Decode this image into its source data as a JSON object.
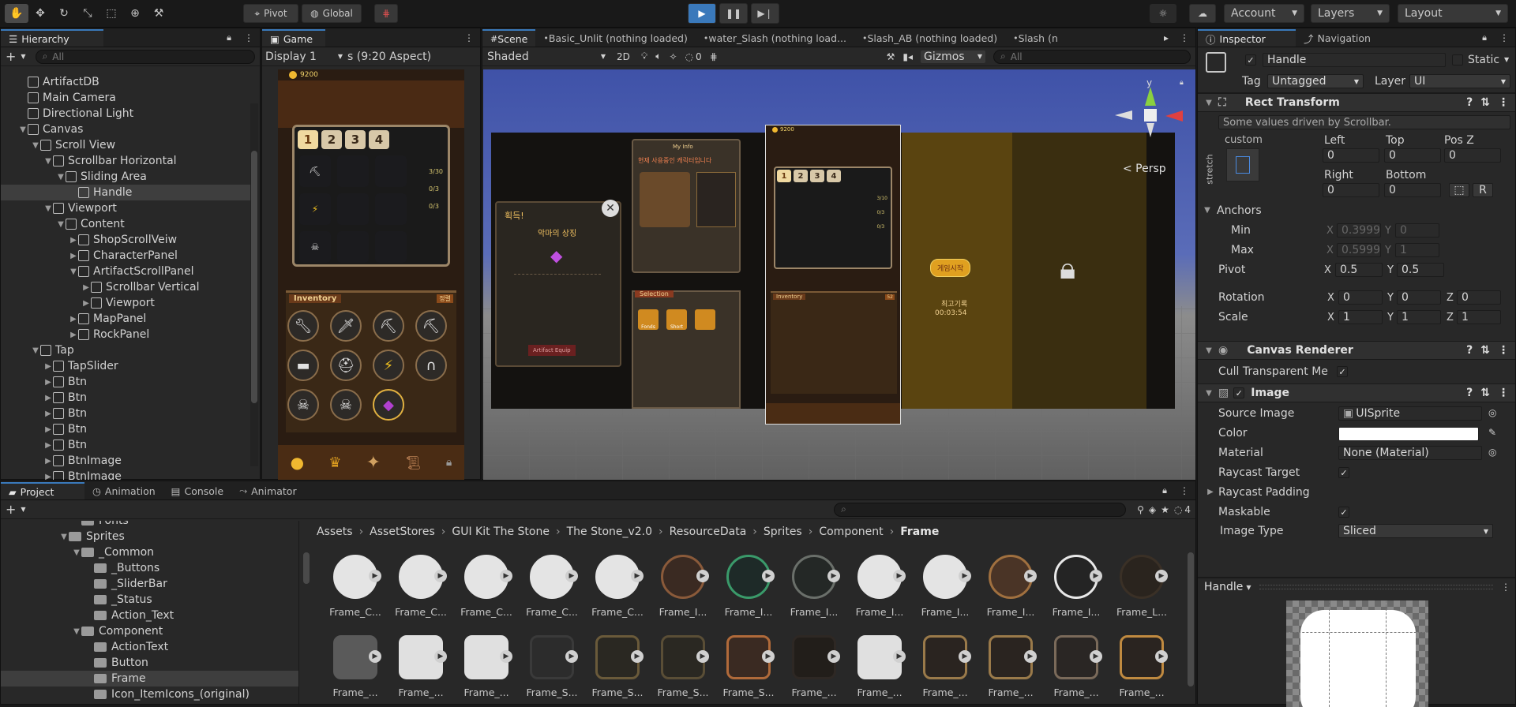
{
  "toolbar": {
    "pivot_label": "Pivot",
    "global_label": "Global",
    "account_label": "Account",
    "layers_label": "Layers",
    "layout_label": "Layout",
    "tool_icons": [
      "hand-icon",
      "move-icon",
      "rotate-icon",
      "scale-icon",
      "rect-icon",
      "transform-icon",
      "custom-tool-icon"
    ]
  },
  "hierarchy": {
    "tab_label": "Hierarchy",
    "search_placeholder": "All",
    "items": [
      {
        "label": "ArtifactDB",
        "indent": 3,
        "arrow": ""
      },
      {
        "label": "Main Camera",
        "indent": 3,
        "arrow": ""
      },
      {
        "label": "Directional Light",
        "indent": 3,
        "arrow": ""
      },
      {
        "label": "Canvas",
        "indent": 3,
        "arrow": "▼"
      },
      {
        "label": "Scroll View",
        "indent": 4,
        "arrow": "▼"
      },
      {
        "label": "Scrollbar Horizontal",
        "indent": 5,
        "arrow": "▼"
      },
      {
        "label": "Sliding Area",
        "indent": 6,
        "arrow": "▼"
      },
      {
        "label": "Handle",
        "indent": 7,
        "arrow": "",
        "selected": true
      },
      {
        "label": "Viewport",
        "indent": 5,
        "arrow": "▼"
      },
      {
        "label": "Content",
        "indent": 6,
        "arrow": "▼"
      },
      {
        "label": "ShopScrollVeiw",
        "indent": 7,
        "arrow": "▶"
      },
      {
        "label": "CharacterPanel",
        "indent": 7,
        "arrow": "▶"
      },
      {
        "label": "ArtifactScrollPanel",
        "indent": 7,
        "arrow": "▼"
      },
      {
        "label": "Scrollbar Vertical",
        "indent": 8,
        "arrow": "▶"
      },
      {
        "label": "Viewport",
        "indent": 8,
        "arrow": "▶"
      },
      {
        "label": "MapPanel",
        "indent": 7,
        "arrow": "▶"
      },
      {
        "label": "RockPanel",
        "indent": 7,
        "arrow": "▶"
      },
      {
        "label": "Tap",
        "indent": 4,
        "arrow": "▼"
      },
      {
        "label": "TapSlider",
        "indent": 5,
        "arrow": "▶"
      },
      {
        "label": "Btn",
        "indent": 5,
        "arrow": "▶"
      },
      {
        "label": "Btn",
        "indent": 5,
        "arrow": "▶"
      },
      {
        "label": "Btn",
        "indent": 5,
        "arrow": "▶"
      },
      {
        "label": "Btn",
        "indent": 5,
        "arrow": "▶"
      },
      {
        "label": "Btn",
        "indent": 5,
        "arrow": "▶"
      },
      {
        "label": "BtnImage",
        "indent": 5,
        "arrow": "▶"
      },
      {
        "label": "BtnImage",
        "indent": 5,
        "arrow": "▶"
      }
    ]
  },
  "game": {
    "tab_label": "Game",
    "display_label": "Display 1",
    "aspect_label": "s (9:20 Aspect)",
    "coin_value": "9200",
    "tabs": [
      "1",
      "2",
      "3",
      "4"
    ],
    "counters": [
      "3/30",
      "0/3",
      "0/3"
    ],
    "inventory_label": "Inventory",
    "inventory_badge": "정렬"
  },
  "scene": {
    "tabs": [
      {
        "label": "Scene",
        "active": true
      },
      {
        "label": "Basic_Unlit (nothing loaded)"
      },
      {
        "label": "water_Slash (nothing load..."
      },
      {
        "label": "Slash_AB (nothing loaded)"
      },
      {
        "label": "Slash (n"
      }
    ],
    "shading_label": "Shaded",
    "mode_2d": "2D",
    "hidden_count": "0",
    "gizmos_label": "Gizmos",
    "search_placeholder": "All",
    "persp_label": "< Persp",
    "gizmo_axis_y": "y",
    "card_popup_title": "획득!",
    "card_popup_item": "악마의 상징",
    "card_popup_btn": "Artifact Equip",
    "my_info_title": "My Info",
    "my_info_subtitle": "현재 사용중인 캐릭터입니다",
    "selection_label": "Selection",
    "selection_items": [
      "Fonds",
      "Short",
      ""
    ],
    "mid_coin": "9200",
    "mid_tabs": [
      "1",
      "2",
      "3",
      "4"
    ],
    "mid_counters": [
      "3/10",
      "0/3",
      "0/3"
    ],
    "mid_inventory_label": "Inventory",
    "mid_inventory_badge": "52",
    "start_btn": "게임시작",
    "best_record_label": "최고기록",
    "best_record_time": "00:03:54"
  },
  "inspector": {
    "tab_label": "Inspector",
    "nav_tab_label": "Navigation",
    "object_name": "Handle",
    "static_label": "Static",
    "tag_label": "Tag",
    "tag_value": "Untagged",
    "layer_label": "Layer",
    "layer_value": "UI",
    "rect_transform": {
      "title": "Rect Transform",
      "note": "Some values driven by Scrollbar.",
      "preset_label": "custom",
      "stretch_label": "stretch",
      "left_label": "Left",
      "left_value": "0",
      "top_label": "Top",
      "top_value": "0",
      "posz_label": "Pos Z",
      "posz_value": "0",
      "right_label": "Right",
      "right_value": "0",
      "bottom_label": "Bottom",
      "bottom_value": "0",
      "anchors_label": "Anchors",
      "min_label": "Min",
      "min_x": "0.3999",
      "min_y": "0",
      "max_label": "Max",
      "max_x": "0.5999",
      "max_y": "1",
      "pivot_label": "Pivot",
      "pivot_x": "0.5",
      "pivot_y": "0.5",
      "rotation_label": "Rotation",
      "rot_x": "0",
      "rot_y": "0",
      "rot_z": "0",
      "scale_label": "Scale",
      "scale_x": "1",
      "scale_y": "1",
      "scale_z": "1",
      "r_button": "R"
    },
    "canvas_renderer": {
      "title": "Canvas Renderer",
      "cull_label": "Cull Transparent Me"
    },
    "image": {
      "title": "Image",
      "source_label": "Source Image",
      "source_value": "UISprite",
      "color_label": "Color",
      "color_value": "#ffffff",
      "material_label": "Material",
      "material_value": "None (Material)",
      "raycast_target_label": "Raycast Target",
      "raycast_padding_label": "Raycast Padding",
      "maskable_label": "Maskable",
      "image_type_label": "Image Type",
      "image_type_value": "Sliced"
    },
    "preview_label": "Handle"
  },
  "project": {
    "tabs": [
      {
        "label": "Project",
        "active": true
      },
      {
        "label": "Animation"
      },
      {
        "label": "Console"
      },
      {
        "label": "Animator"
      }
    ],
    "hidden_count": "4",
    "folders": [
      {
        "label": "Fonts",
        "indent": 6,
        "arrow": ""
      },
      {
        "label": "Sprites",
        "indent": 5,
        "arrow": "▼"
      },
      {
        "label": "_Common",
        "indent": 6,
        "arrow": "▼"
      },
      {
        "label": "_Buttons",
        "indent": 7,
        "arrow": ""
      },
      {
        "label": "_SliderBar",
        "indent": 7,
        "arrow": ""
      },
      {
        "label": "_Status",
        "indent": 7,
        "arrow": ""
      },
      {
        "label": "Action_Text",
        "indent": 7,
        "arrow": ""
      },
      {
        "label": "Component",
        "indent": 6,
        "arrow": "▼"
      },
      {
        "label": "ActionText",
        "indent": 7,
        "arrow": ""
      },
      {
        "label": "Button",
        "indent": 7,
        "arrow": ""
      },
      {
        "label": "Frame",
        "indent": 7,
        "arrow": "",
        "selected": true
      },
      {
        "label": "Icon_ItemIcons_(original)",
        "indent": 7,
        "arrow": ""
      }
    ],
    "breadcrumb": [
      "Assets",
      "AssetStores",
      "GUI Kit The Stone",
      "The Stone_v2.0",
      "ResourceData",
      "Sprites",
      "Component",
      "Frame"
    ],
    "assets_row1": [
      {
        "label": "Frame_C...",
        "color": "#e4e4e4",
        "ring": "#e4e4e4"
      },
      {
        "label": "Frame_C...",
        "color": "#e4e4e4",
        "ring": "#e4e4e4"
      },
      {
        "label": "Frame_C...",
        "color": "#e4e4e4",
        "ring": "#e4e4e4"
      },
      {
        "label": "Frame_C...",
        "color": "#e4e4e4",
        "ring": "#e4e4e4"
      },
      {
        "label": "Frame_C...",
        "color": "#e4e4e4",
        "ring": "#e4e4e4"
      },
      {
        "label": "Frame_I...",
        "color": "#3a2a22",
        "ring": "#8a5a3a"
      },
      {
        "label": "Frame_I...",
        "color": "#1e2a28",
        "ring": "#3a9a6a"
      },
      {
        "label": "Frame_I...",
        "color": "#242826",
        "ring": "#6a6f6a"
      },
      {
        "label": "Frame_I...",
        "color": "#e4e4e4",
        "ring": "#e4e4e4"
      },
      {
        "label": "Frame_I...",
        "color": "#e4e4e4",
        "ring": "#e4e4e4"
      },
      {
        "label": "Frame_I...",
        "color": "#4a3426",
        "ring": "#a0703f"
      },
      {
        "label": "Frame_I...",
        "color": "#242424",
        "ring": "#e8e8e8"
      },
      {
        "label": "Frame_L...",
        "color": "#2a241e",
        "ring": "#3a3026"
      }
    ],
    "assets_row2": [
      {
        "label": "Frame_...",
        "color": "#5a5a5a",
        "ring": "#5a5a5a"
      },
      {
        "label": "Frame_...",
        "color": "#e0e0e0",
        "ring": "#e0e0e0"
      },
      {
        "label": "Frame_...",
        "color": "#e0e0e0",
        "ring": "#e0e0e0"
      },
      {
        "label": "Frame_S...",
        "color": "#2c2c2c",
        "ring": "#3a3a3a"
      },
      {
        "label": "Frame_S...",
        "color": "#2a2822",
        "ring": "#6a5a3a"
      },
      {
        "label": "Frame_S...",
        "color": "#2a2822",
        "ring": "#5a4e36"
      },
      {
        "label": "Frame_S...",
        "color": "#3a2a22",
        "ring": "#b06a3a"
      },
      {
        "label": "Frame_...",
        "color": "#221e1a",
        "ring": "#2e2824"
      },
      {
        "label": "Frame_...",
        "color": "#e0e0e0",
        "ring": "#e0e0e0"
      },
      {
        "label": "Frame_...",
        "color": "#2a2420",
        "ring": "#9a7a4a"
      },
      {
        "label": "Frame_...",
        "color": "#2a2420",
        "ring": "#9a7a4a"
      },
      {
        "label": "Frame_...",
        "color": "#2a2624",
        "ring": "#7a6a5a"
      },
      {
        "label": "Frame_...",
        "color": "#2a2420",
        "ring": "#c08a40"
      }
    ]
  },
  "colors": {
    "accent": "#3a79bb",
    "play_button": "#3a79bb",
    "selection": "#3e3e3e"
  }
}
